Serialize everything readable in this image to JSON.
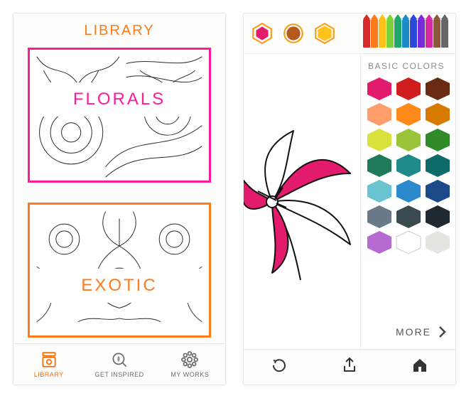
{
  "library": {
    "title": "LIBRARY",
    "categories": [
      {
        "id": "florals",
        "label": "FLORALS",
        "accent": "#ff1a9c"
      },
      {
        "id": "exotic",
        "label": "EXOTIC",
        "accent": "#ff7a1a"
      }
    ],
    "tabs": [
      {
        "id": "library",
        "label": "LIBRARY",
        "active": true
      },
      {
        "id": "getinspired",
        "label": "GET INSPIRED",
        "active": false
      },
      {
        "id": "myworks",
        "label": "MY WORKS",
        "active": false
      }
    ]
  },
  "coloring": {
    "selectors": [
      {
        "color": "#e31b6d",
        "ring": "#ff9a1a",
        "selected": true
      },
      {
        "color": "#b55a1c",
        "ring": "#ff9a1a",
        "selected": false
      },
      {
        "color": "#ffc21a",
        "ring": "#ff9a1a",
        "selected": false
      }
    ],
    "pencils": [
      "#d82a2a",
      "#ff7a1a",
      "#ffc21a",
      "#7bd13a",
      "#1fa66a",
      "#1a8acb",
      "#2a4bd8",
      "#7a2ad8",
      "#d82aa6",
      "#8a5a3a",
      "#666666"
    ],
    "palette_title": "BASIC COLORS",
    "palette": [
      "#e31b6d",
      "#d11d1d",
      "#6b2a12",
      "#ff9e6a",
      "#ff8a1a",
      "#d97a00",
      "#d9e23a",
      "#9ac43a",
      "#2f8a2a",
      "#1f7a5a",
      "#1f8a8a",
      "#0f6a6a",
      "#6ac3d1",
      "#2a8acb",
      "#1a4a8a",
      "#6a7a88",
      "#3a4a50",
      "#202830",
      "#b46ad1",
      "#ffffff",
      "#e4e4e0"
    ],
    "more_label": "MORE",
    "toolbar": {
      "undo": "undo",
      "share": "share",
      "home": "home"
    },
    "canvas_fill": "#e31b6d"
  }
}
